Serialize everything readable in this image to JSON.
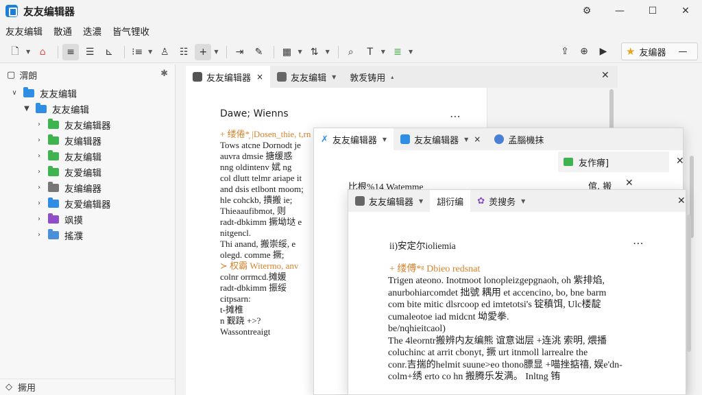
{
  "app": {
    "title": "友友编辑器"
  },
  "menu": [
    "友友编辑",
    "散通",
    "迭濃",
    "皆气锂收"
  ],
  "toolbar": {
    "profile_label": "友编器"
  },
  "sidebar": {
    "header": "渭朗",
    "footer": "撅用",
    "tree": [
      {
        "label": "友友编辑",
        "level": 0,
        "expanded": true,
        "color": "#2f8de4"
      },
      {
        "label": "友友编辑",
        "level": 1,
        "expanded": true,
        "color": "#2f8de4"
      },
      {
        "label": "友友编辑器",
        "level": 2,
        "color": "#3fb34f"
      },
      {
        "label": "友编辑器",
        "level": 2,
        "color": "#3fb34f"
      },
      {
        "label": "友友编辑",
        "level": 2,
        "color": "#3fb34f"
      },
      {
        "label": "友爱编辑",
        "level": 2,
        "color": "#3fb34f"
      },
      {
        "label": "友编编器",
        "level": 2,
        "color": "#777777"
      },
      {
        "label": "友爱编辑器",
        "level": 2,
        "color": "#2f8de4"
      },
      {
        "label": "飒摸",
        "level": 2,
        "color": "#8e4fc6"
      },
      {
        "label": "搖濮",
        "level": 2,
        "color": "#4a90d9"
      }
    ]
  },
  "tabs_back": [
    {
      "label": "友友编辑器",
      "active": true,
      "close": "×"
    },
    {
      "label": "友友编辑",
      "dropdown": "▼"
    },
    {
      "label": "敦叐铸用",
      "dropdown": "▴"
    }
  ],
  "doc_back": {
    "heading": "Dawe; Wienns",
    "lines": [
      "+ 缕倦*᷊ |Dosen_thie, t,rn",
      "Tows atcne Dornodt je",
      "auvra dmsie 搪缓惑",
      "nng oldintenv 娬 ng",
      "col dlutt telmr ariape it",
      "and dsis etlbont moom;",
      "hle cohckb, 撌搬 ie;",
      "Thieaaufibmot, 则",
      "  radt-dbkimm 撅坳垯 e",
      "  nitgencl.",
      "  Thi anand, 搬崇绥, e",
      "olegd. comme 撅;",
      "≻ 权霸 Witermo, anv",
      "colnr orrmcd.摊媛",
      "radt-dbkimm 振绥",
      "citpsarn:",
      "  t-摊椎",
      "  n 觐跷 +>?",
      "      Wassontreaigt"
    ]
  },
  "window2": {
    "tabs": [
      {
        "label": "友友编辑器",
        "dropdown": "▼"
      },
      {
        "label": "友友编辑器",
        "dropdown": "▼",
        "close": "×"
      },
      {
        "label": "孟腦機抹"
      }
    ],
    "subpanel_label": "友作瘠]",
    "heading": "比根%14 Watemme",
    "side_text": "倌, 搬"
  },
  "window3": {
    "tabs": [
      {
        "label": "友友编辑器",
        "dropdown": "▼"
      },
      {
        "label": "翃衍编"
      },
      {
        "label": "羙搜务",
        "dropdown": "▼"
      }
    ],
    "heading": "ii)安定尔ioliemia",
    "subheading": "+ 缕傅*ᵍ Dbieo redsnat",
    "lines": [
      "Trigen ateono. Inotmoot lonopleizgepgnaoh, oh 紫排焰,",
      "anurbohiarcomdet 拙號 耦用 et accencino, bo, bne barm",
      "com bite mitic dlsrcoop ed imtetotsi's 锭稹饵, Ulc楼靛",
      "cumaleotoe iad midcnt 坳愛拳.",
      "        be/nqhieitcaol)",
      "     The 4leorntr搬辨内友编熊 谊意诎层 +连洮 索明, 煨播",
      "coluchinc at arrit cbonyt, 撅 urt itnmoll larrealre the",
      "conr.吉揣的helmit suune>eo thono膘显 +喵挫掂禧, 娱e'dn-",
      "colm+绣 erto co hn 搬腾乐发满。               Inltng 铕 "
    ]
  }
}
